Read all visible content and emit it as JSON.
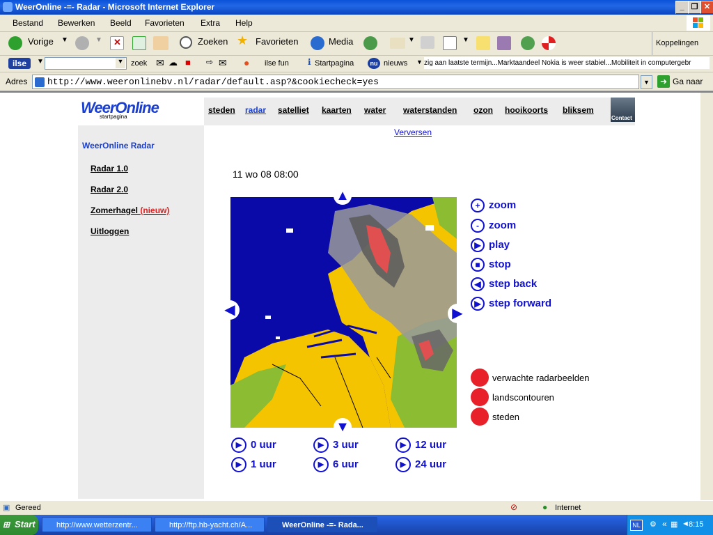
{
  "window": {
    "title": "WeerOnline -=- Radar - Microsoft Internet Explorer"
  },
  "menu": [
    "Bestand",
    "Bewerken",
    "Beeld",
    "Favorieten",
    "Extra",
    "Help"
  ],
  "toolbar": {
    "back": "Vorige",
    "search": "Zoeken",
    "favorites": "Favorieten",
    "media": "Media",
    "links": "Koppelingen"
  },
  "ilsebar": {
    "logo": "ilse",
    "search": "zoek",
    "fun": "ilse fun",
    "startpage": "Startpagina",
    "news_logo": "nu",
    "news": "nieuws",
    "ticker": "zig aan laatste termijn...Marktaandeel Nokia is weer stabiel...Mobiliteit in computergebr"
  },
  "address": {
    "label": "Adres",
    "url": "http://www.weeronlinebv.nl/radar/default.asp?&cookiecheck=yes",
    "go": "Ga naar"
  },
  "site": {
    "logo": "WeerOnline",
    "logo_sub": "startpagina",
    "nav": [
      "steden",
      "radar",
      "satelliet",
      "kaarten",
      "water",
      "waterstanden",
      "ozon",
      "hooikoorts",
      "bliksem"
    ],
    "contact": "Contact",
    "refresh": "Verversen",
    "sidebar_title": "WeerOnline Radar",
    "sidebar": [
      "Radar 1.0",
      "Radar 2.0",
      "Zomerhagel",
      "Uitloggen"
    ],
    "sidebar_new": "(nieuw)",
    "timestamp": "11 wo 08 08:00"
  },
  "controls": [
    "zoom",
    "zoom",
    "play",
    "stop",
    "step back",
    "step forward"
  ],
  "layers": [
    "verwachte radarbeelden",
    "landscontouren",
    "steden"
  ],
  "hours": [
    "0 uur",
    "3 uur",
    "12 uur",
    "1 uur",
    "6 uur",
    "24 uur"
  ],
  "status": {
    "text": "Gereed",
    "zone": "Internet"
  },
  "taskbar": {
    "start": "Start",
    "tasks": [
      "http://www.wetterzentr...",
      "http://ftp.hb-yacht.ch/A...",
      "WeerOnline -=- Rada..."
    ],
    "lang": "NL",
    "clock": "8:15"
  },
  "colors": {
    "link": "#1010d0",
    "dot": "#e8202a",
    "sea": "#0a0aa8",
    "land_nl": "#f5c400",
    "land_de": "#8cbc32"
  }
}
